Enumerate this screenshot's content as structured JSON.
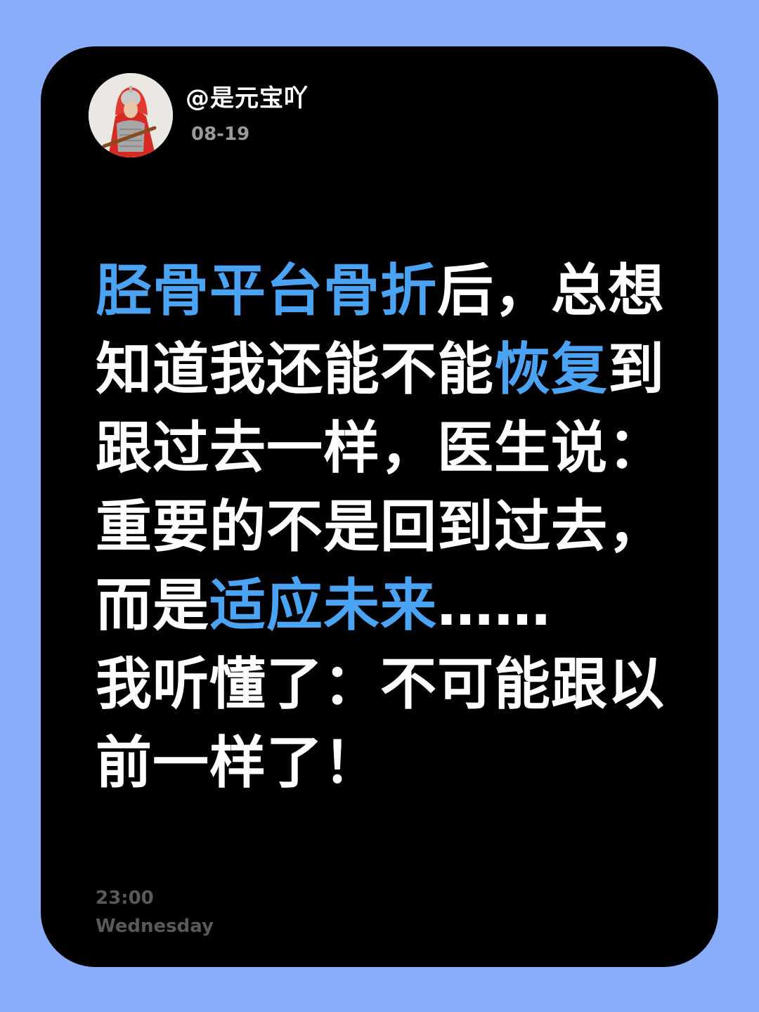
{
  "colors": {
    "background": "#8aadfb",
    "card": "#000000",
    "text": "#ffffff",
    "highlight": "#4aa3f3",
    "muted": "#9a9a9a",
    "footer": "#595959"
  },
  "header": {
    "avatar_icon": "user-avatar-photo",
    "username": "@是元宝吖",
    "date": "08-19"
  },
  "post": {
    "segments": [
      {
        "text": "胫骨平台骨折",
        "highlight": true
      },
      {
        "text": "后，总想知道我还能不能",
        "highlight": false
      },
      {
        "text": "恢复",
        "highlight": true
      },
      {
        "text": "到跟过去一样，医生说：重要的不是回到过去，而是",
        "highlight": false
      },
      {
        "text": "适应未来",
        "highlight": true
      },
      {
        "text": "……",
        "highlight": false
      },
      {
        "text": "我听懂了：不可能跟以前一样了！",
        "highlight": false,
        "newline": true
      }
    ]
  },
  "footer": {
    "time": "23:00",
    "weekday": "Wednesday"
  }
}
